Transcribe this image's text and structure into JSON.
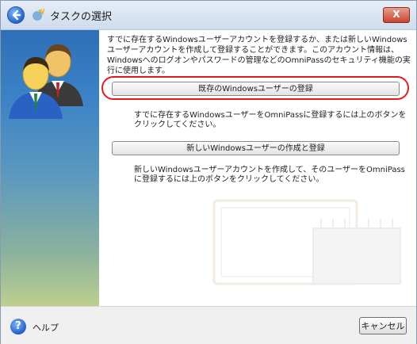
{
  "window": {
    "title": "タスクの選択",
    "close_label": "X"
  },
  "main": {
    "description": "すでに存在するWindowsユーザーアカウントを登録するか、または新しいWindowsユーザーアカウントを作成して登録することができます。このアカウント情報は、Windowsへのログオンやパスワードの管理などのOmniPassのセキュリティ機能の実行に使用します。",
    "existing_button_label": "既存のWindowsユーザーの登録",
    "existing_note": "すでに存在するWindowsユーザーをOmniPassに登録するには上のボタンをクリックしてください。",
    "new_button_label": "新しいWindowsユーザーの作成と登録",
    "new_note": "新しいWindowsユーザーアカウントを作成して、そのユーザーをOmniPassに登録するには上のボタンをクリックしてください。"
  },
  "footer": {
    "help_label": "ヘルプ",
    "cancel_label": "キャンセル"
  },
  "colors": {
    "highlight": "#e31b1b",
    "sidebar_top": "#2e6fb7",
    "sidebar_bottom": "#bccf8e"
  }
}
